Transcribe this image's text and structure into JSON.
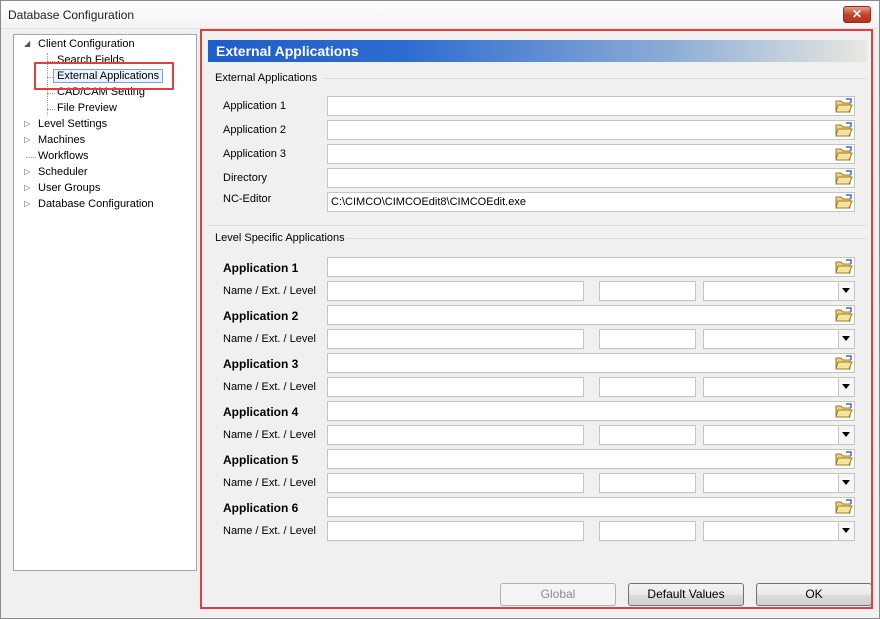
{
  "window": {
    "title": "Database Configuration",
    "close_symbol": "✕"
  },
  "tree": {
    "items": [
      {
        "label": "Client Configuration",
        "expander": "◢"
      },
      {
        "label": "Search Fields"
      },
      {
        "label": "External Applications"
      },
      {
        "label": "CAD/CAM Setting"
      },
      {
        "label": "File Preview"
      },
      {
        "label": "Level Settings",
        "expander": "▷"
      },
      {
        "label": "Machines",
        "expander": "▷"
      },
      {
        "label": "Workflows"
      },
      {
        "label": "Scheduler",
        "expander": "▷"
      },
      {
        "label": "User Groups",
        "expander": "▷"
      },
      {
        "label": "Database Configuration",
        "expander": "▷"
      }
    ]
  },
  "panel": {
    "header": "External Applications",
    "external_group": {
      "title": "External Applications",
      "rows": [
        {
          "label": "Application 1",
          "value": ""
        },
        {
          "label": "Application 2",
          "value": ""
        },
        {
          "label": "Application 3",
          "value": ""
        },
        {
          "label": "Directory",
          "value": ""
        },
        {
          "label": "NC-Editor",
          "value": "C:\\CIMCO\\CIMCOEdit8\\CIMCOEdit.exe"
        }
      ]
    },
    "level_group": {
      "title": "Level Specific Applications",
      "apps": [
        {
          "label": "Application 1",
          "sub_label": "Name / Ext. / Level"
        },
        {
          "label": "Application 2",
          "sub_label": "Name / Ext. / Level"
        },
        {
          "label": "Application 3",
          "sub_label": "Name / Ext. / Level"
        },
        {
          "label": "Application 4",
          "sub_label": "Name / Ext. / Level"
        },
        {
          "label": "Application 5",
          "sub_label": "Name / Ext. / Level"
        },
        {
          "label": "Application 6",
          "sub_label": "Name / Ext. / Level"
        }
      ]
    }
  },
  "buttons": {
    "global": "Global",
    "default_values": "Default Values",
    "ok": "OK"
  },
  "icons": {
    "browse": "folder-open-icon",
    "dropdown": "chevron-down-icon"
  }
}
